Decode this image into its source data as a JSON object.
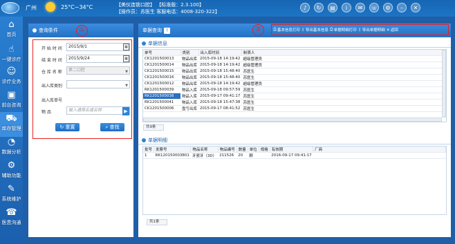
{
  "header": {
    "city": "广州",
    "temperature": "25°C~34°C",
    "clinic_line1": "【美仪连锁口腔】    【标准版：2.3.100】",
    "clinic_line2": "【操作员：苏医生  客服电话：4008-320-322】"
  },
  "sidebar": {
    "items": [
      {
        "label": "首页",
        "icon": "home-icon"
      },
      {
        "label": "一键诊疗",
        "icon": "hand-icon"
      },
      {
        "label": "诊疗业务",
        "icon": "person-icon"
      },
      {
        "label": "前台咨询",
        "icon": "desk-icon"
      },
      {
        "label": "库存管理",
        "icon": "cart-icon"
      },
      {
        "label": "数据分析",
        "icon": "chart-icon"
      },
      {
        "label": "辅助功能",
        "icon": "gear-icon"
      },
      {
        "label": "系统维护",
        "icon": "wrench-icon"
      },
      {
        "label": "医患沟通",
        "icon": "chat-icon"
      }
    ]
  },
  "query": {
    "title": "查询条件",
    "badge": "①",
    "start_label": "开 始 时 间",
    "start_value": "2015/9/1",
    "end_label": "结 束 时 间",
    "end_value": "2015/9/24",
    "warehouse_label": "仓 库 名 称",
    "warehouse_value": "第二口腔",
    "io_type_label": "出入库类别",
    "io_no_label": "出入库单号",
    "item_label": "物        品",
    "item_placeholder": "输入通用名或名称",
    "reset_label": "重置",
    "search_label": "查找"
  },
  "main": {
    "title": "单据查询",
    "badge": "②",
    "toolbar": [
      "基本信息打印",
      "导出基本信息",
      "单据明细打印",
      "导出单据明细",
      "返回"
    ],
    "info_title": "单据信息",
    "info_columns": [
      "单号",
      "类别",
      "出入库时间",
      "制表人"
    ],
    "info_rows": [
      [
        "CK1201500013",
        "物品出库",
        "2015-09-18 14:19:42",
        "超级管理员"
      ],
      [
        "CK1201500014",
        "物品出库",
        "2015-09-18 14:19:42",
        "超级管理员"
      ],
      [
        "CK1201500015",
        "物品出库",
        "2015-09-18 15:48:40",
        "苏医生"
      ],
      [
        "CK1201500016",
        "物品出库",
        "2015-09-18 15:48:40",
        "苏医生"
      ],
      [
        "CK1201500012",
        "物品出库",
        "2015-09-18 14:19:42",
        "超级管理员"
      ],
      [
        "RK1201500039",
        "物品入库",
        "2015-09-18 09:57:59",
        "苏医生"
      ],
      [
        "RK1201500038",
        "物品入库",
        "2015-09-17 09:41:17",
        "苏医生"
      ],
      [
        "RK1201500041",
        "物品入库",
        "2015-09-18 15:47:38",
        "苏医生"
      ],
      [
        "CK1201500006",
        "盘亏出库",
        "2015-09-17 08:41:52",
        "苏医生"
      ]
    ],
    "info_total": "共9条",
    "detail_title": "单据明细",
    "detail_columns": [
      "批号",
      "发票号",
      "物品名称",
      "物品编号",
      "数量",
      "单位",
      "规格",
      "有效期",
      "厂商"
    ],
    "detail_rows": [
      [
        "1",
        "RK120150003801",
        "牙瓷牙（3D）",
        "211526",
        "20",
        "颗",
        "",
        "2016-09-17 09:41:17",
        ""
      ]
    ],
    "detail_total": "共1条"
  }
}
